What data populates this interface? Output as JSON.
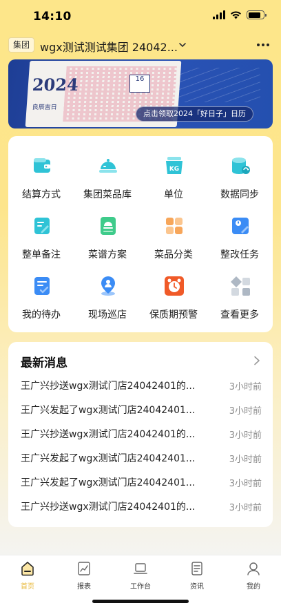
{
  "status_bar": {
    "time": "14:10",
    "battery_level": 0.85
  },
  "header": {
    "badge": "集团",
    "group_name": "wgx测试测试集团 24042...",
    "chevron_icon": "chevron-down-icon",
    "more_icon": "more-horizontal-icon"
  },
  "banner": {
    "year_text": "2024",
    "year_sub": "良辰吉日",
    "card_text": "16",
    "cta": "点击领取2024「好日子」日历"
  },
  "grid": {
    "items": [
      {
        "label": "结算方式",
        "icon": "wallet-icon",
        "color": "#2FC3D6"
      },
      {
        "label": "集团菜品库",
        "icon": "dish-cover-icon",
        "color": "#2FC3D6"
      },
      {
        "label": "单位",
        "icon": "kg-weight-icon",
        "color": "#2FC3D6"
      },
      {
        "label": "数据同步",
        "icon": "database-sync-icon",
        "color": "#2FC3D6"
      },
      {
        "label": "整单备注",
        "icon": "note-pencil-icon",
        "color": "#2FC3D6"
      },
      {
        "label": "菜谱方案",
        "icon": "recipe-doc-icon",
        "color": "#3FCB8B"
      },
      {
        "label": "菜品分类",
        "icon": "category-grid-icon",
        "color": "#F7A65A"
      },
      {
        "label": "整改任务",
        "icon": "rectify-task-icon",
        "color": "#3B8CF5"
      },
      {
        "label": "我的待办",
        "icon": "todo-check-icon",
        "color": "#3B8CF5"
      },
      {
        "label": "现场巡店",
        "icon": "location-person-icon",
        "color": "#3B8CF5"
      },
      {
        "label": "保质期预警",
        "icon": "alarm-clock-icon",
        "color": "#F05A28"
      },
      {
        "label": "查看更多",
        "icon": "more-apps-icon",
        "color": "#B8C1CC"
      }
    ]
  },
  "news": {
    "title": "最新消息",
    "chevron_icon": "chevron-right-icon",
    "items": [
      {
        "text": "王广兴抄送wgx测试门店24042401的...",
        "time": "3小时前"
      },
      {
        "text": "王广兴发起了wgx测试门店24042401...",
        "time": "3小时前"
      },
      {
        "text": "王广兴抄送wgx测试门店24042401的...",
        "time": "3小时前"
      },
      {
        "text": "王广兴发起了wgx测试门店24042401...",
        "time": "3小时前"
      },
      {
        "text": "王广兴发起了wgx测试门店24042401...",
        "time": "3小时前"
      },
      {
        "text": "王广兴抄送wgx测试门店24042401的...",
        "time": "3小时前"
      }
    ]
  },
  "tabbar": {
    "active_color": "#E8B93C",
    "tabs": [
      {
        "label": "首页",
        "icon": "home-icon"
      },
      {
        "label": "报表",
        "icon": "report-chart-icon"
      },
      {
        "label": "工作台",
        "icon": "laptop-icon"
      },
      {
        "label": "资讯",
        "icon": "news-doc-icon"
      },
      {
        "label": "我的",
        "icon": "user-icon"
      }
    ]
  }
}
